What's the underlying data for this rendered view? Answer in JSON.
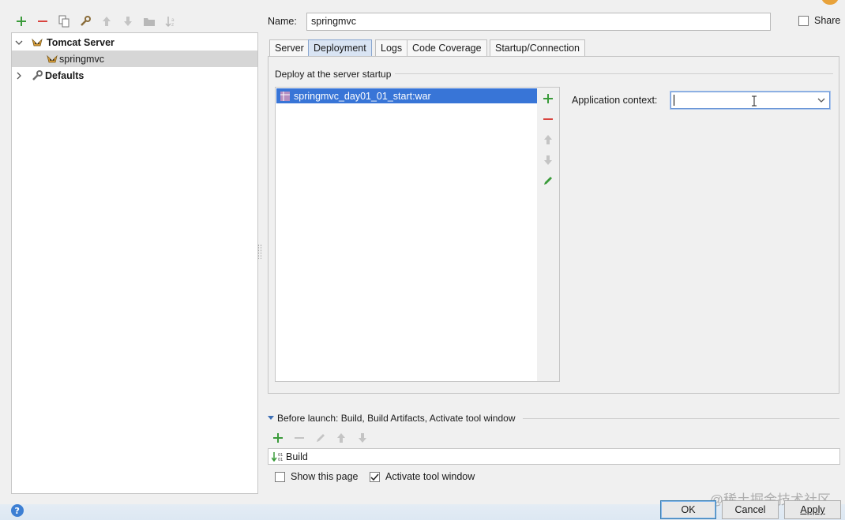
{
  "toolbar": {
    "icons": [
      "add-icon",
      "remove-icon",
      "copy-icon",
      "wrench-icon",
      "move-up-icon",
      "move-down-icon",
      "folder-icon",
      "sort-icon"
    ]
  },
  "tree": {
    "group_label": "Tomcat Server",
    "child_label": "springmvc",
    "defaults_label": "Defaults"
  },
  "name": {
    "label": "Name:",
    "value": "springmvc"
  },
  "share": {
    "label": "Share",
    "checked": false
  },
  "tabs": [
    {
      "label": "Server",
      "active": false
    },
    {
      "label": "Deployment",
      "active": true
    },
    {
      "label": "Logs",
      "active": false
    },
    {
      "label": "Code Coverage",
      "active": false
    },
    {
      "label": "Startup/Connection",
      "active": false
    }
  ],
  "deploy": {
    "section_title": "Deploy at the server startup",
    "artifacts": [
      "springmvc_day01_01_start:war"
    ],
    "app_context_label": "Application context:",
    "app_context_value": ""
  },
  "before_launch": {
    "title": "Before launch: Build, Build Artifacts, Activate tool window",
    "items": [
      "Build"
    ]
  },
  "options": {
    "show_page_label": "Show this page",
    "show_page_checked": false,
    "activate_label": "Activate tool window",
    "activate_checked": true
  },
  "buttons": {
    "ok": "OK",
    "cancel": "Cancel",
    "apply": "Apply"
  },
  "watermark": "@稀土掘金技术社区",
  "colors": {
    "selection": "#3875d7",
    "add": "#3a9b3a",
    "remove": "#d9443f",
    "active_tab": "#d9e4f3"
  }
}
